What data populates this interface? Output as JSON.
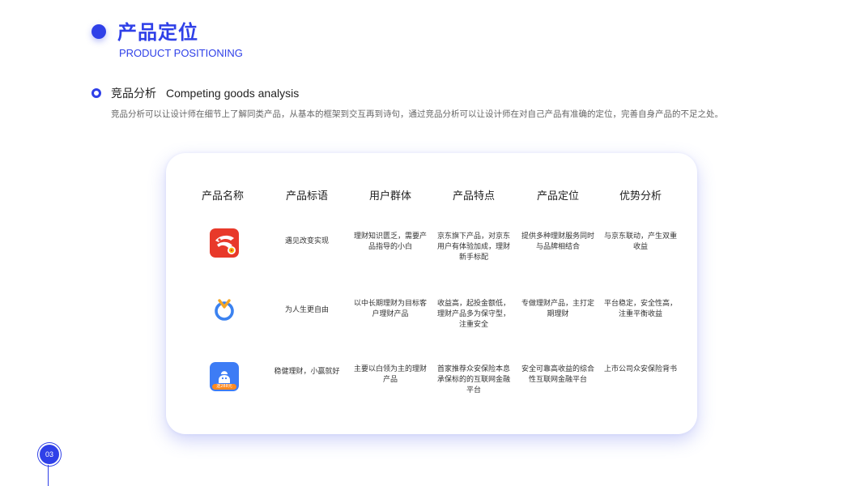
{
  "header": {
    "title": "产品定位",
    "subtitle": "PRODUCT POSITIONING"
  },
  "section": {
    "title_cn": "竞品分析",
    "title_en": "Competing goods analysis",
    "description": "竞品分析可以让设计师在细节上了解同类产品，从基本的框架到交互再到诗句，通过竞品分析可以让设计师在对自己产品有准确的定位，完善自身产品的不足之处。"
  },
  "table": {
    "columns": [
      "产品名称",
      "产品标语",
      "用户群体",
      "产品特点",
      "产品定位",
      "优势分析"
    ],
    "rows": [
      {
        "icon": "jd-finance-app-icon",
        "slogan": "遇见改变实现",
        "audience": "理财知识匮乏，需要产品指导的小白",
        "features": "京东旗下产品，对京东用户有体验加成，理财新手标配",
        "positioning": "提供多种理财服务同时与品牌相结合",
        "advantages": "与京东联动，产生双重收益"
      },
      {
        "icon": "yingmi-app-icon",
        "slogan": "为人生更自由",
        "audience": "以中长期理财为目标客户理财产品",
        "features": "收益高，起投金额低，理财产品多为保守型，注重安全",
        "positioning": "专做理财产品，主打定期理财",
        "advantages": "平台稳定，安全性高，注重平衡收益"
      },
      {
        "icon": "zhongan-wallet-app-icon",
        "icon_badge": "送288元",
        "slogan": "稳健理财，小赢就好",
        "audience": "主要以白领为主的理财产品",
        "features": "首家推荐众安保险本息承保标的的互联网金融平台",
        "positioning": "安全可靠高收益的综合性互联网金融平台",
        "advantages": "上市公司众安保险背书"
      }
    ]
  },
  "footer": {
    "page_number": "03"
  },
  "colors": {
    "accent": "#2f40e8",
    "jd_red": "#e8392a",
    "badge_orange": "#ff8a1f"
  }
}
